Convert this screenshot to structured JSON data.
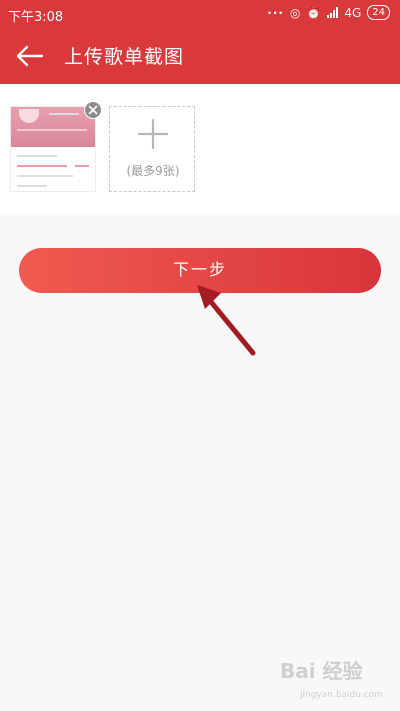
{
  "status_bar": {
    "time": "下午3:08",
    "network": "4G",
    "battery": "24"
  },
  "header": {
    "title": "上传歌单截图"
  },
  "upload": {
    "add_hint": "(最多9张)"
  },
  "actions": {
    "next_label": "下一步"
  },
  "watermark": {
    "brand": "Bai 经验",
    "site": "jingyan.baidu.com"
  },
  "colors": {
    "primary": "#d9393a",
    "button_start": "#f15a50",
    "button_end": "#d8353b"
  }
}
